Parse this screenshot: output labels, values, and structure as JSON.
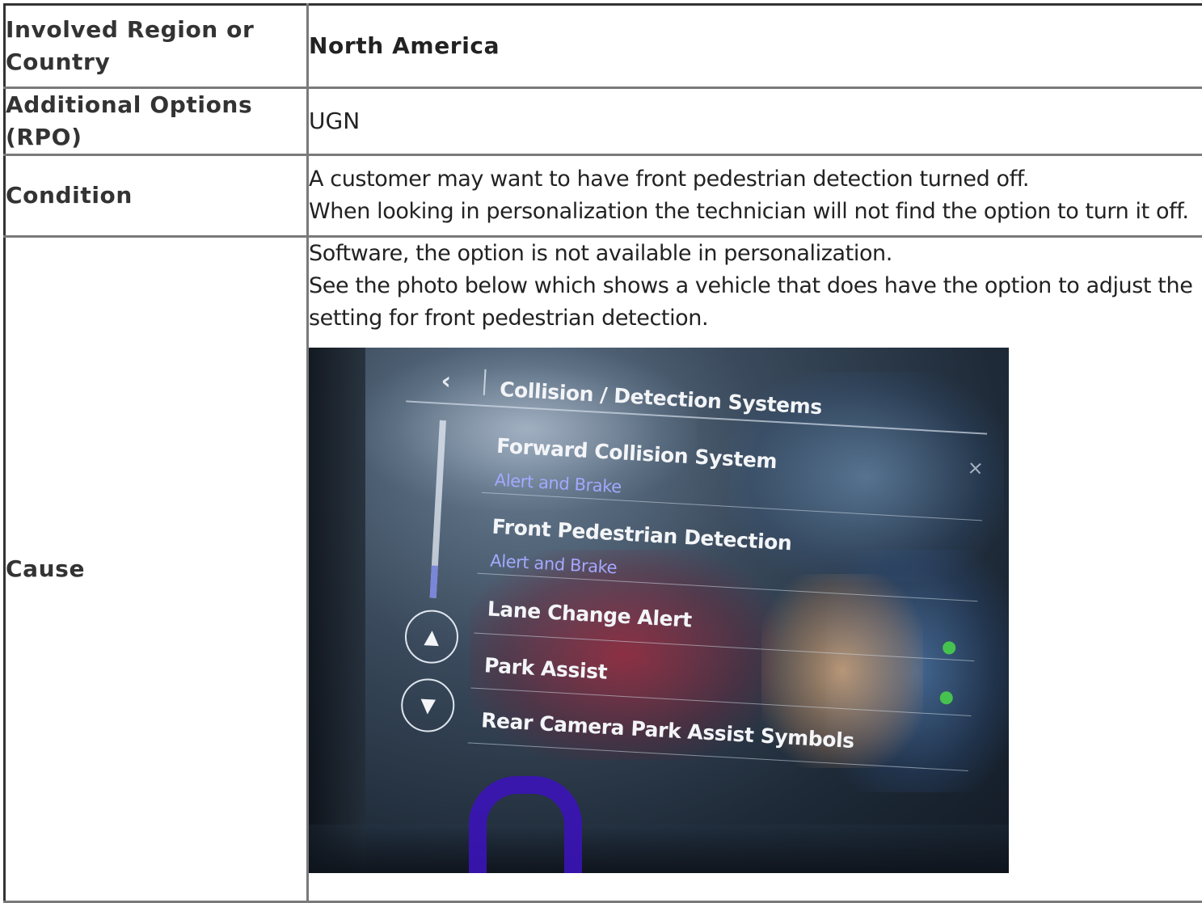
{
  "table": {
    "rows": [
      {
        "label": "Involved Region or Country",
        "value": "North America"
      },
      {
        "label": "Additional Options (RPO)",
        "value": "UGN"
      },
      {
        "label": "Condition",
        "lines": [
          "A customer may want to have front pedestrian detection turned off.",
          "When looking in personalization the technician will not find the option to turn it off."
        ]
      },
      {
        "label": "Cause",
        "lines": [
          "Software, the option is not available in personalization.",
          "See the photo below which shows a vehicle that does have the option to adjust the setting for front pedestrian detection."
        ]
      }
    ]
  },
  "photo": {
    "screen_title": "Collision / Detection Systems",
    "items": [
      {
        "label": "Forward Collision System",
        "sub": "Alert and Brake"
      },
      {
        "label": "Front Pedestrian Detection",
        "sub": "Alert and Brake"
      },
      {
        "label": "Lane Change Alert"
      },
      {
        "label": "Park Assist"
      },
      {
        "label": "Rear Camera Park Assist Symbols"
      }
    ],
    "icons": {
      "back": "chevron-left-icon",
      "close": "close-icon",
      "scroll_up": "triangle-up-icon",
      "scroll_down": "triangle-down-icon"
    },
    "colors": {
      "sub_text": "#a4a8ff",
      "toggle_on": "#46c24f",
      "annotation": "#3b14b8"
    }
  }
}
